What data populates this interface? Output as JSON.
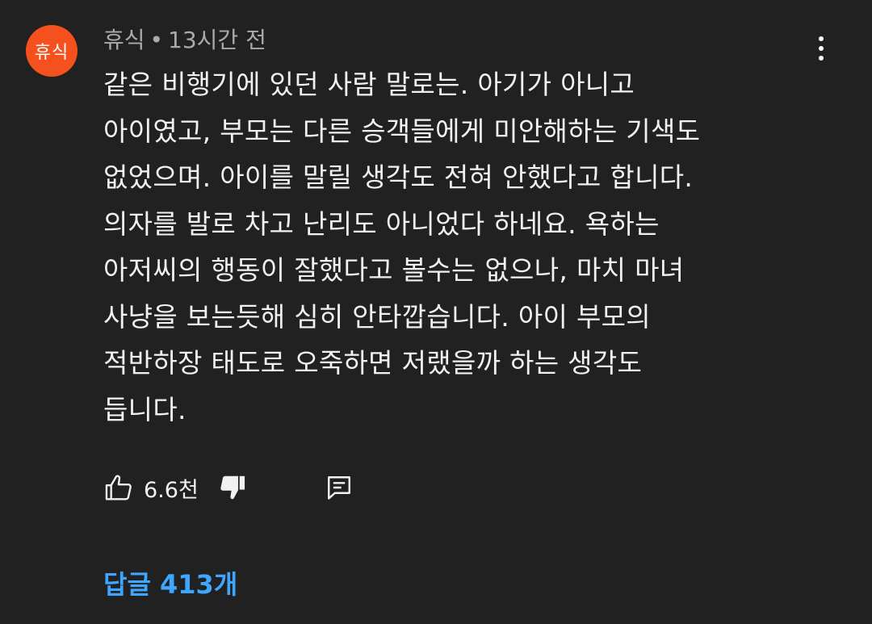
{
  "comment": {
    "author": "휴식",
    "avatar_text": "휴식",
    "avatar_color": "#f4511e",
    "separator": "•",
    "time": "13시간 전",
    "body_lines": [
      "같은 비행기에 있던 사람 말로는. 아기가 아니고",
      "아이였고, 부모는 다른 승객들에게 미안해하는 기색도",
      "없었으며. 아이를 말릴 생각도 전혀 안했다고 합니다.",
      "의자를 발로 차고 난리도 아니었다 하네요. 욕하는",
      "아저씨의 행동이 잘했다고 볼수는 없으나, 마치 마녀",
      "사냥을 보는듯해 심히 안타깝습니다. 아이 부모의",
      "적반하장 태도로 오죽하면 저랬을까 하는 생각도",
      "듭니다."
    ],
    "like_count": "6.6천",
    "replies_label": "답글 413개",
    "icons": {
      "more": "more-vertical-icon",
      "like": "thumbs-up-icon",
      "dislike": "thumbs-down-icon",
      "reply": "comment-reply-icon"
    },
    "colors": {
      "background": "#212121",
      "text": "#f1f1f1",
      "meta": "#aaaaaa",
      "link": "#3ea6ff"
    }
  }
}
